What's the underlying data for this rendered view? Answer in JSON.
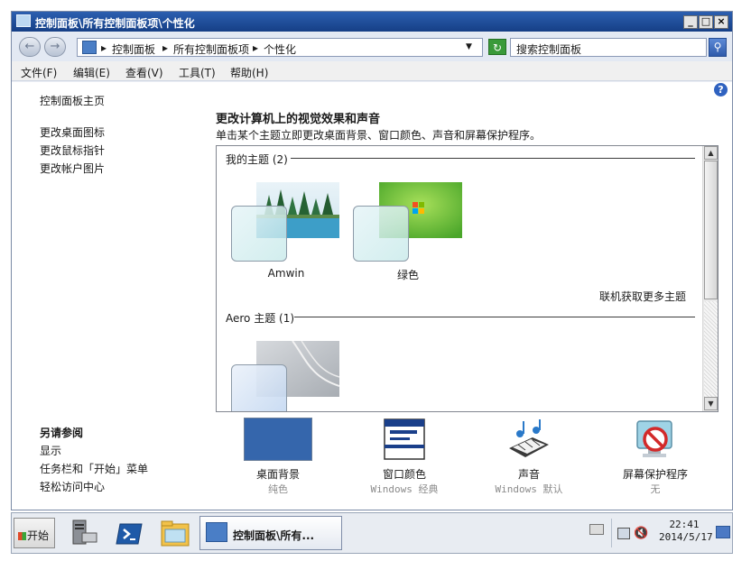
{
  "window": {
    "title": "控制面板\\所有控制面板项\\个性化",
    "min_label": "_",
    "max_label": "□",
    "close_label": "×"
  },
  "address": {
    "crumbs": [
      "控制面板",
      "所有控制面板项",
      "个性化"
    ],
    "separator": "▸",
    "dropdown": "▼",
    "search_placeholder": "搜索控制面板"
  },
  "menu": {
    "items": [
      "文件(F)",
      "编辑(E)",
      "查看(V)",
      "工具(T)",
      "帮助(H)"
    ]
  },
  "left_pane": {
    "home": "控制面板主页",
    "links": [
      "更改桌面图标",
      "更改鼠标指针",
      "更改帐户图片"
    ],
    "see_also_title": "另请参阅",
    "see_also": [
      "显示",
      "任务栏和「开始」菜单",
      "轻松访问中心"
    ]
  },
  "main": {
    "title": "更改计算机上的视觉效果和声音",
    "subtitle": "单击某个主题立即更改桌面背景、窗口颜色、声音和屏幕保护程序。",
    "my_themes_header": "我的主题 (2)",
    "my_themes": [
      {
        "name": "Amwin"
      },
      {
        "name": "绿色"
      }
    ],
    "online_link": "联机获取更多主题",
    "aero_header": "Aero 主题 (1)"
  },
  "bottom": [
    {
      "name": "桌面背景",
      "value": "纯色"
    },
    {
      "name": "窗口颜色",
      "value": "Windows 经典"
    },
    {
      "name": "声音",
      "value": "Windows 默认"
    },
    {
      "name": "屏幕保护程序",
      "value": "无"
    }
  ],
  "taskbar": {
    "start": "开始",
    "active_task": "控制面板\\所有...",
    "time": "22:41",
    "date": "2014/5/17"
  },
  "colors": {
    "desktop_bg_swatch": "#3566ac",
    "title_bar": "#1f4d9a",
    "accent_green": "#3a9a3a"
  },
  "icons": [
    "control-panel-icon",
    "back-arrow-icon",
    "forward-arrow-icon",
    "refresh-icon",
    "search-icon",
    "help-icon",
    "window-color-icon",
    "sound-icon",
    "screensaver-icon",
    "server-manager-icon",
    "powershell-icon",
    "explorer-folder-icon",
    "keyboard-icon",
    "network-icon",
    "volume-icon",
    "show-desktop-icon"
  ]
}
